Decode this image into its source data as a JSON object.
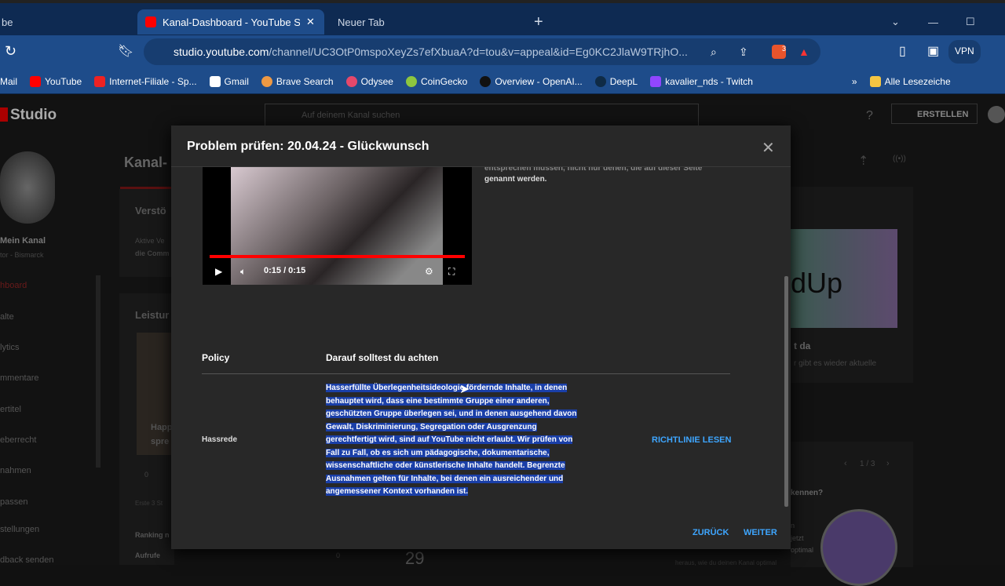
{
  "browser": {
    "tabs": [
      {
        "label": "be"
      },
      {
        "label": "Kanal-Dashboard - YouTube Stu"
      },
      {
        "label": "Neuer Tab"
      }
    ],
    "new_tab": "+",
    "url_domain": "studio.youtube.com",
    "url_path": "/channel/UC3OtP0mspoXeyZs7efXbuaA?d=tou&v=appeal&id=Eg0KC2JlaW9TRjhO...",
    "vpn": "VPN",
    "brave_badge": "3",
    "bookmarks": [
      "Mail",
      "YouTube",
      "Internet-Filiale - Sp...",
      "Gmail",
      "Brave Search",
      "Odysee",
      "CoinGecko",
      "Overview - OpenAI...",
      "DeepL",
      "kavalier_nds - Twitch"
    ],
    "bookmark_more": "»",
    "all_bookmarks": "Alle Lesezeiche"
  },
  "studio": {
    "logo": "Studio",
    "search_placeholder": "Auf deinem Kanal suchen",
    "create": "ERSTELLEN",
    "channel_name": "Mein Kanal",
    "channel_sub": "tor - Bismarck",
    "nav": [
      "hboard",
      "alte",
      "lytics",
      "mmentare",
      "ertitel",
      "eberrecht",
      "nahmen",
      "passen",
      "stellungen",
      "dback senden"
    ],
    "page_title": "Kanal-",
    "card1_title": "Verstö",
    "card1_text1": "Aktive Ve",
    "card1_text2": "die Comm",
    "card2_title": "Leistur",
    "card2_video": "Happ",
    "card2_video2": "spre",
    "card2_stat": "0",
    "first3": "Erste 3 St",
    "ranking": "Ranking n",
    "views": "Aufrufe",
    "views_val": "0",
    "big_num": "29",
    "news_title": "t da",
    "news_text": "r gibt es wieder aktuelle",
    "pager": "1 / 3",
    "tip_title": "kennen?",
    "tip_lines": [
      "n",
      "jetzt",
      "optimal"
    ],
    "tip_bottom": "heraus, wie du deinen Kanal optimal"
  },
  "modal": {
    "title": "Problem prüfen: 20.04.24 - Glückwunsch",
    "video_time": "0:15 / 0:15",
    "side_text_cut": "entsprechen müssen, nicht nur denen, die auf dieser Seite",
    "side_text": "genannt werden.",
    "col_policy": "Policy",
    "col_attention": "Darauf solltest du achten",
    "policy_name": "Hassrede",
    "policy_desc": "Hasserfüllte Überlegenheitsideologie fördernde Inhalte, in denen behauptet wird, dass eine bestimmte Gruppe einer anderen, geschützten Gruppe überlegen sei, und in denen ausgehend davon Gewalt, Diskriminierung, Segregation oder Ausgrenzung gerechtfertigt wird, sind auf YouTube nicht erlaubt. Wir prüfen von Fall zu Fall, ob es sich um pädagogische, dokumentarische, wissenschaftliche oder künstlerische Inhalte handelt. Begrenzte Ausnahmen gelten für Inhalte, bei denen ein ausreichender und angemessener Kontext vorhanden ist.",
    "read_policy": "RICHTLINIE LESEN",
    "back": "ZURÜCK",
    "next": "WEITER",
    "video_progress_percent": 100
  },
  "colors": {
    "accent": "#3ea6ff",
    "selection": "#1a3fa8",
    "youtube_red": "#ff0000",
    "browser_blue": "#1e4c8a"
  }
}
